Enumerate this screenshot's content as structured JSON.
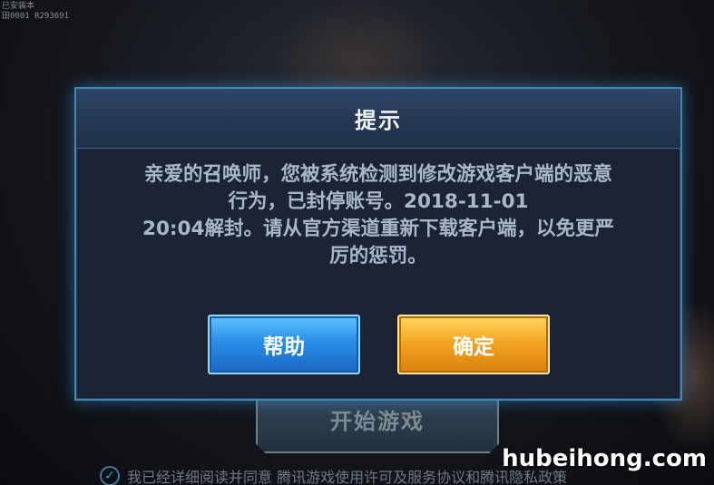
{
  "background": {
    "corner_text": "已安装本\n田0001 R293691",
    "start_button_label": "开始游戏",
    "agreement_text": "我已经详细阅读并同意 腾讯游戏使用许可及服务协议和腾讯隐私政策"
  },
  "dialog": {
    "title": "提示",
    "message_lines": [
      "亲爱的召唤师，您被系统检测到修改游戏客户端的恶意",
      "行为，已封停账号。2018-11-01",
      "20:04解封。请从官方渠道重新下载客户端，以免更严",
      "厉的惩罚。"
    ],
    "help_label": "帮助",
    "ok_label": "确定"
  },
  "watermark": "hubeihong.com"
}
